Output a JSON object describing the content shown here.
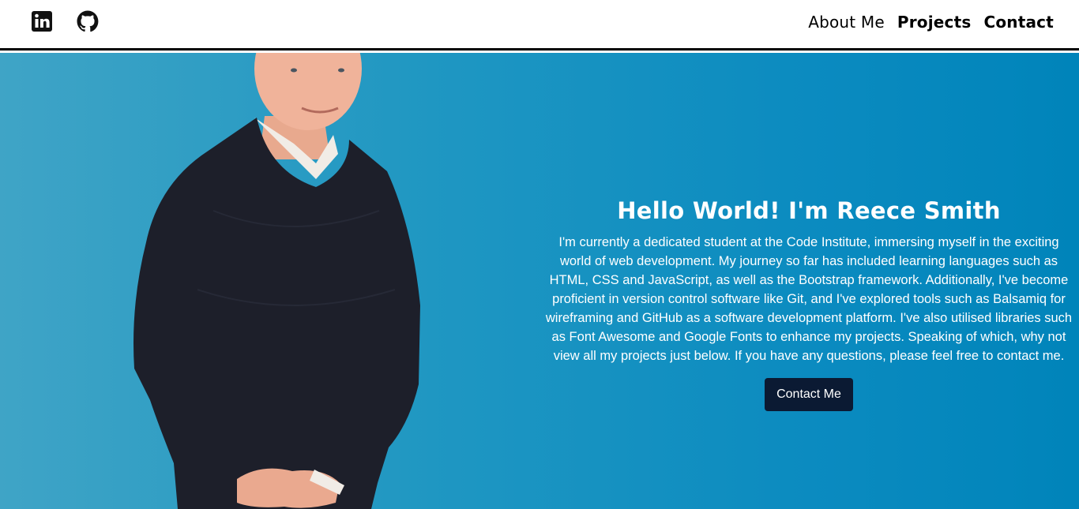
{
  "header": {
    "social": [
      {
        "name": "LinkedIn",
        "icon": "linkedin-icon"
      },
      {
        "name": "GitHub",
        "icon": "github-icon"
      }
    ],
    "nav": {
      "about": "About Me",
      "projects": "Projects",
      "contact": "Contact"
    }
  },
  "hero": {
    "title": "Hello World! I'm Reece Smith",
    "paragraph": "I'm currently a dedicated student at the Code Institute, immersing myself in the exciting world of web development. My journey so far has included learning languages such as HTML, CSS and JavaScript, as well as the Bootstrap framework. Additionally, I've become proficient in version control software like Git, and I've explored tools such as Balsamiq for wireframing and GitHub as a software development platform. I've also utilised libraries such as Font Awesome and Google Fonts to enhance my projects. Speaking of which, why not view all my projects just below. If you have any questions, please feel free to contact me.",
    "button": "Contact Me"
  },
  "colors": {
    "hero_gradient_start": "#3fa4c6",
    "hero_gradient_end": "#0084ba",
    "button_bg": "#0b1a33",
    "nav_border": "#000000"
  }
}
